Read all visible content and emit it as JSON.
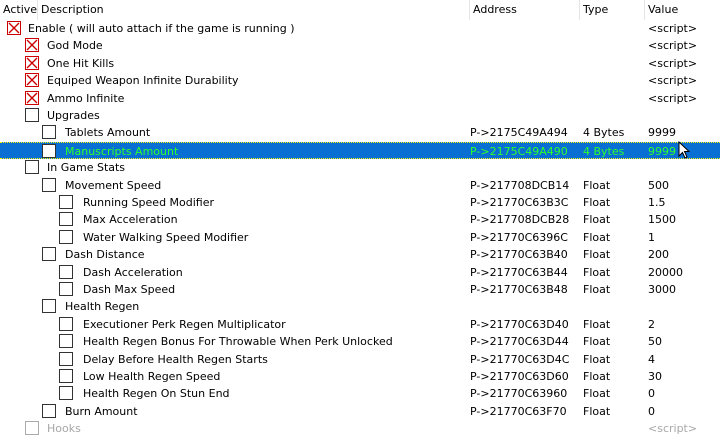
{
  "header": {
    "active": "Active",
    "description": "Description",
    "address": "Address",
    "type": "Type",
    "value": "Value"
  },
  "rows": [
    {
      "level": 0,
      "checked": true,
      "desc": "Enable  ( will auto attach if the game is running )",
      "addr": "",
      "type": "",
      "value": "<script>"
    },
    {
      "level": 1,
      "checked": true,
      "desc": "God Mode",
      "addr": "",
      "type": "",
      "value": "<script>"
    },
    {
      "level": 1,
      "checked": true,
      "desc": "One Hit Kills",
      "addr": "",
      "type": "",
      "value": "<script>"
    },
    {
      "level": 1,
      "checked": true,
      "desc": "Equiped Weapon Infinite Durability",
      "addr": "",
      "type": "",
      "value": "<script>"
    },
    {
      "level": 1,
      "checked": true,
      "desc": "Ammo Infinite",
      "addr": "",
      "type": "",
      "value": "<script>"
    },
    {
      "level": 1,
      "checked": false,
      "desc": "Upgrades",
      "addr": "",
      "type": "",
      "value": ""
    },
    {
      "level": 2,
      "checked": false,
      "desc": "Tablets Amount",
      "addr": "P->2175C49A494",
      "type": "4 Bytes",
      "value": "9999"
    },
    {
      "level": 2,
      "checked": false,
      "desc": "Manuscripts Amount",
      "addr": "P->2175C49A490",
      "type": "4 Bytes",
      "value": "9999",
      "selected": true
    },
    {
      "level": 1,
      "checked": false,
      "desc": "In Game Stats",
      "addr": "",
      "type": "",
      "value": ""
    },
    {
      "level": 2,
      "checked": false,
      "desc": "Movement Speed",
      "addr": "P->217708DCB14",
      "type": "Float",
      "value": "500"
    },
    {
      "level": 3,
      "checked": false,
      "desc": "Running Speed Modifier",
      "addr": "P->21770C63B3C",
      "type": "Float",
      "value": "1.5"
    },
    {
      "level": 3,
      "checked": false,
      "desc": "Max Acceleration",
      "addr": "P->217708DCB28",
      "type": "Float",
      "value": "1500"
    },
    {
      "level": 3,
      "checked": false,
      "desc": "Water Walking Speed Modifier",
      "addr": "P->21770C6396C",
      "type": "Float",
      "value": "1"
    },
    {
      "level": 2,
      "checked": false,
      "desc": "Dash Distance",
      "addr": "P->21770C63B40",
      "type": "Float",
      "value": "200"
    },
    {
      "level": 3,
      "checked": false,
      "desc": "Dash Acceleration",
      "addr": "P->21770C63B44",
      "type": "Float",
      "value": "20000"
    },
    {
      "level": 3,
      "checked": false,
      "desc": "Dash Max Speed",
      "addr": "P->21770C63B48",
      "type": "Float",
      "value": "3000"
    },
    {
      "level": 2,
      "checked": false,
      "desc": "Health Regen",
      "addr": "",
      "type": "",
      "value": ""
    },
    {
      "level": 3,
      "checked": false,
      "desc": "Executioner Perk Regen Multiplicator",
      "addr": "P->21770C63D40",
      "type": "Float",
      "value": "2"
    },
    {
      "level": 3,
      "checked": false,
      "desc": "Health Regen Bonus For Throwable When Perk Unlocked",
      "addr": "P->21770C63D44",
      "type": "Float",
      "value": "50"
    },
    {
      "level": 3,
      "checked": false,
      "desc": "Delay Before Health Regen Starts",
      "addr": "P->21770C63D4C",
      "type": "Float",
      "value": "4"
    },
    {
      "level": 3,
      "checked": false,
      "desc": "Low Health Regen Speed",
      "addr": "P->21770C63D60",
      "type": "Float",
      "value": "30"
    },
    {
      "level": 3,
      "checked": false,
      "desc": "Health Regen On Stun End",
      "addr": "P->21770C63960",
      "type": "Float",
      "value": "0"
    },
    {
      "level": 2,
      "checked": false,
      "desc": "Burn Amount",
      "addr": "P->21770C63F70",
      "type": "Float",
      "value": "0"
    },
    {
      "level": 1,
      "checked": false,
      "desc": "Hooks",
      "addr": "",
      "type": "",
      "value": "<script>",
      "disabled": true
    }
  ],
  "icons": {
    "checked": "red-x-icon",
    "cursor": "mouse-pointer-icon"
  },
  "colors": {
    "selection": "#0a6fd2",
    "selected_text": "#2cff2c",
    "check_x": "#cc0000"
  }
}
